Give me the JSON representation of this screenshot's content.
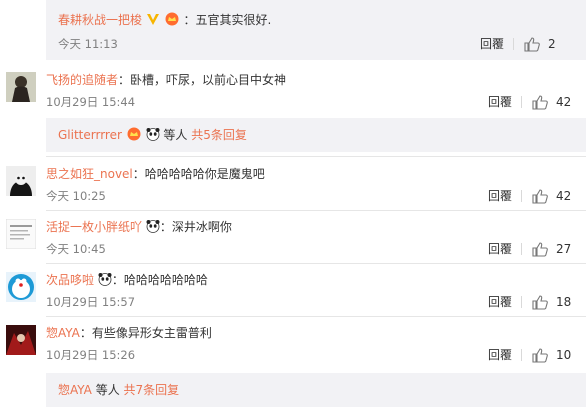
{
  "top_reply": {
    "user": "春耕秋战一把梭",
    "text": "：五官其实很好.",
    "time": "今天 11:13",
    "reply_label": "回覆",
    "likes": "2"
  },
  "comments": [
    {
      "user": "飞扬的追随者",
      "text": "：卧槽，吓尿，以前心目中女神",
      "time": "10月29日 15:44",
      "reply_label": "回覆",
      "likes": "42"
    },
    {
      "user": "思之如狂_novel",
      "text": "：哈哈哈哈哈你是魔鬼吧",
      "time": "今天 10:25",
      "reply_label": "回覆",
      "likes": "42"
    },
    {
      "user": "活捉一枚小胖纸吖",
      "text": "：深井冰啊你",
      "time": "今天 10:45",
      "reply_label": "回覆",
      "likes": "27"
    },
    {
      "user": "次品哆啦",
      "text": "：哈哈哈哈哈哈哈",
      "time": "10月29日 15:57",
      "reply_label": "回覆",
      "likes": "18"
    },
    {
      "user": "惣AYA",
      "text": "：有些像异形女主雷普利",
      "time": "10月29日 15:26",
      "reply_label": "回覆",
      "likes": "10"
    }
  ],
  "summaries": [
    {
      "user": "Glitterrrrer",
      "suffix": " 等人",
      "more": "共5条回复"
    },
    {
      "user": "惣AYA",
      "suffix": " 等人",
      "more": "共7条回复"
    }
  ],
  "colors": {
    "nick": "#eb7350",
    "reply_bg": "#f2f2f5",
    "meta": "#808080"
  }
}
